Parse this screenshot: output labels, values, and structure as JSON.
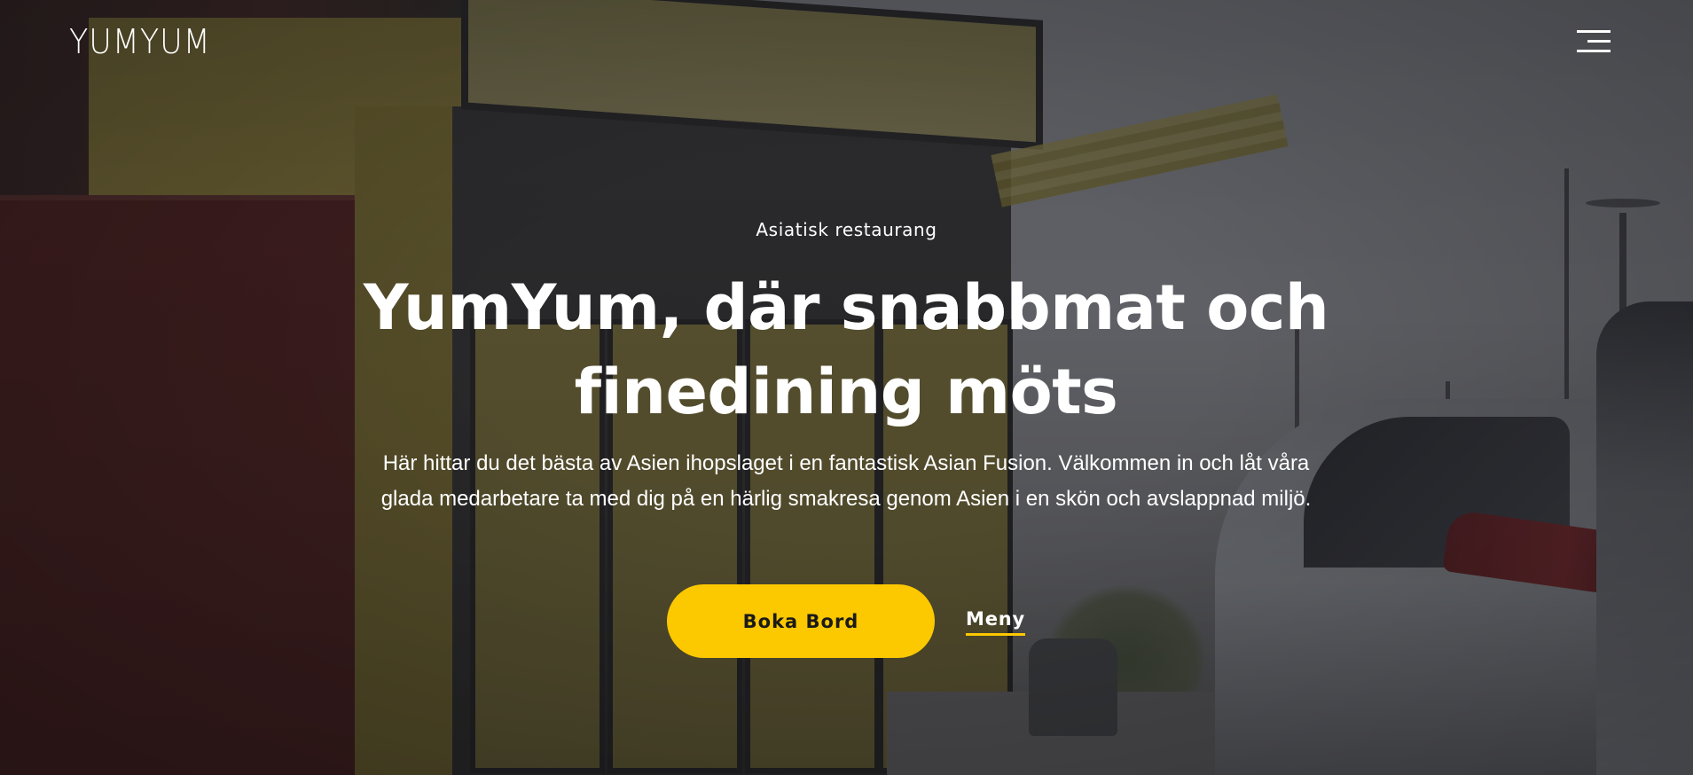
{
  "header": {
    "logo_text": "YUMYUM",
    "menu_toggle_icon": "hamburger-menu-icon"
  },
  "hero": {
    "eyebrow": "Asiatisk restaurang",
    "headline": "YumYum, där snabbmat och finedining möts",
    "lead": "Här hittar du det bästa av Asien ihopslaget i en fantastisk Asian Fusion. Välkommen in och låt våra glada medarbetare ta med dig på en härlig smakresa genom Asien i en skön och avslappnad miljö.",
    "primary_button": "Boka Bord",
    "secondary_link": "Meny"
  },
  "colors": {
    "accent": "#fcc800",
    "text": "#ffffff",
    "button_text": "#1a1a1a"
  }
}
